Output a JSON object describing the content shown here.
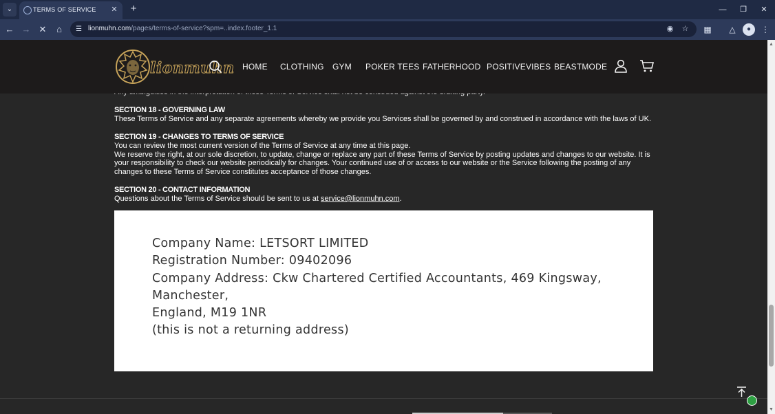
{
  "browser": {
    "tab_title": "TERMS OF SERVICE",
    "url_host": "lionmuhn.com",
    "url_path": "/pages/terms-of-service?spm=..index.footer_1.1"
  },
  "header": {
    "logo_text": "lionmuhn",
    "nav": [
      "HOME",
      "CLOTHING",
      "GYM",
      "POKER TEES",
      "FATHERHOOD",
      "POSITIVEVIBES",
      "BEASTMODE"
    ]
  },
  "content": {
    "partial_line": "Any ambiguities in the interpretation of these Terms of Service shall not be construed against the drafting party.",
    "s18_title": "SECTION 18 - GOVERNING LAW",
    "s18_body": "These Terms of Service and any separate agreements whereby we provide you Services shall be governed by and construed in accordance with the laws of UK.",
    "s19_title": "SECTION 19 - CHANGES TO TERMS OF SERVICE",
    "s19_p1": "You can review the most current version of the Terms of Service at any time at this page.",
    "s19_p2": "We reserve the right, at our sole discretion, to update, change or replace any part of these Terms of Service by posting updates and changes to our website. It is your responsibility to check our website periodically for changes. Your continued use of or access to our website or the Service following the posting of any changes to these Terms of Service constitutes acceptance of those changes.",
    "s20_title": "SECTION 20 - CONTACT INFORMATION",
    "s20_prefix": "Questions about the Terms of Service should be sent to us at ",
    "s20_email": "service@lionmuhn.com",
    "s20_suffix": "."
  },
  "company": {
    "name": "Company Name: LETSORT LIMITED",
    "reg": "Registration Number: 09402096",
    "address_1": "Company Address: Ckw Chartered Certified Accountants, 469 Kingsway, Manchester,",
    "address_2": "England, M19 1NR",
    "note": "(this is not a returning address)"
  },
  "colors": {
    "header_bg": "#1d1b1b",
    "page_bg": "#272727",
    "gold": "#c8a45a",
    "badge_green": "#2ea043"
  }
}
